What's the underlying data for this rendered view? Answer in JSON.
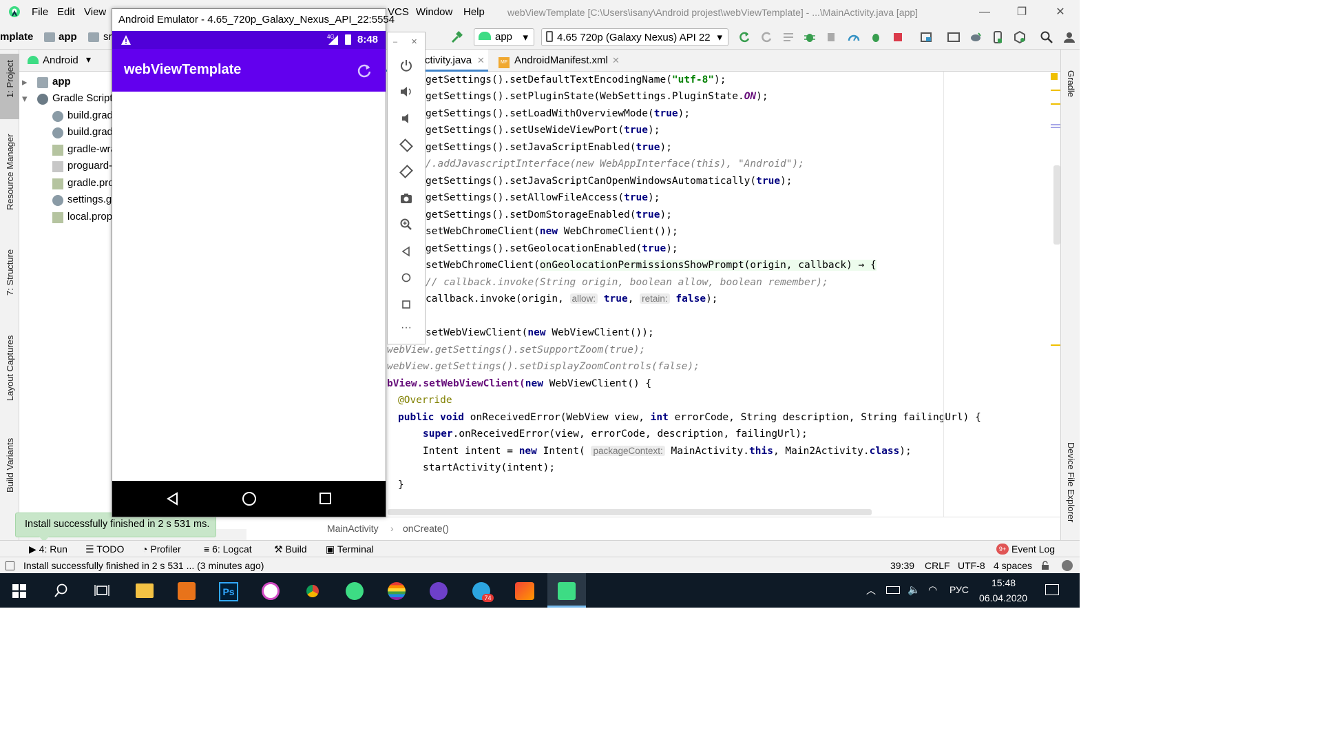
{
  "menu": {
    "items": [
      "File",
      "Edit",
      "View",
      "VCS",
      "Window",
      "Help"
    ],
    "window_title": "webViewTemplate [C:\\Users\\isany\\Android projest\\webViewTemplate] - ...\\MainActivity.java [app]"
  },
  "toolbar": {
    "crumb_project": "mplate",
    "crumb_app": "app",
    "crumb_src": "sr",
    "run_config": "app",
    "device": "4.65  720p (Galaxy Nexus) API 22"
  },
  "left_tabs": {
    "project": "1: Project",
    "resource_manager": "Resource Manager",
    "structure": "7: Structure",
    "layout_captures": "Layout Captures",
    "build_variants": "Build Variants"
  },
  "right_tabs": {
    "gradle": "Gradle",
    "device_explorer": "Device File Explorer"
  },
  "project_panel": {
    "view_mode": "Android",
    "items": [
      "app",
      "Gradle Scripts",
      "build.grad",
      "build.grad",
      "gradle-wra",
      "proguard-",
      "gradle.pro",
      "settings.g",
      "local.prop"
    ]
  },
  "editor_tabs": [
    "ctivity.java",
    "AndroidManifest.xml"
  ],
  "code": {
    "l1a": "getSettings().setDefaultTextEncodingName(",
    "l1s": "\"utf-8\"",
    "l1b": ");",
    "l2a": "getSettings().setPluginState(WebSettings.PluginState.",
    "l2f": "ON",
    "l2b": ");",
    "l3a": "getSettings().setLoadWithOverviewMode(",
    "l3k": "true",
    "l3b": ");",
    "l4a": "getSettings().setUseWideViewPort(",
    "l4k": "true",
    "l4b": ");",
    "l5a": "getSettings().setJavaScriptEnabled(",
    "l5k": "true",
    "l5b": ");",
    "l6": "/.addJavascriptInterface(new WebAppInterface(this), \"Android\");",
    "l7a": "getSettings().setJavaScriptCanOpenWindowsAutomatically(",
    "l7k": "true",
    "l7b": ");",
    "l8a": "getSettings().setAllowFileAccess(",
    "l8k": "true",
    "l8b": ");",
    "l9a": "getSettings().setDomStorageEnabled(",
    "l9k": "true",
    "l9b": ");",
    "l10a": "setWebChromeClient(",
    "l10k": "new",
    "l10b": " WebChromeClient());",
    "l11a": "getSettings().setGeolocationEnabled(",
    "l11k": "true",
    "l11b": ");",
    "l12a": "setWebChromeClient(",
    "l12h": "onGeolocationPermissionsShowPrompt(origin, callback) → {",
    "l13": "// callback.invoke(String origin, boolean allow, boolean remember);",
    "l14a": "callback.invoke(origin, ",
    "l14h1": "allow:",
    "l14k1": " true",
    "l14c": ", ",
    "l14h2": "retain:",
    "l14k2": " false",
    "l14b": ");",
    "l16a": "setWebViewClient(",
    "l16k": "new",
    "l16b": " WebViewClient());",
    "l17": "webView.getSettings().setSupportZoom(true);",
    "l18": "webView.getSettings().setDisplayZoomControls(false);",
    "l19a": "bView.setWebViewClient(",
    "l19k": "new",
    "l19b": " WebViewClient() {",
    "l20": "@Override",
    "l21k": "public void",
    "l21a": " onReceivedError(WebView view, ",
    "l21k2": "int",
    "l21b": " errorCode, String description, String failingUrl) {",
    "l22k": "super",
    "l22a": ".onReceivedError(view, errorCode, description, failingUrl);",
    "l23a": "Intent intent = ",
    "l23k": "new",
    "l23b": " Intent( ",
    "l23h": "packageContext:",
    "l23c": " MainActivity.",
    "l23k2": "this",
    "l23d": ", Main2Activity.",
    "l23k3": "class",
    "l23e": ");",
    "l24": "startActivity(intent);",
    "l25": "}"
  },
  "breadcrumb": {
    "cls": "MainActivity",
    "method": "onCreate()"
  },
  "tool_windows": {
    "run": "4: Run",
    "todo": "TODO",
    "profiler": "Profiler",
    "logcat": "6: Logcat",
    "build": "Build",
    "terminal": "Terminal",
    "event_log": "Event Log",
    "event_badge": "9+"
  },
  "status": {
    "message": "Install successfully finished in 2 s 531 ... (3 minutes ago)",
    "position": "39:39",
    "line_sep": "CRLF",
    "encoding": "UTF-8",
    "indent": "4 spaces"
  },
  "popup": {
    "message": "Install successfully finished in 2 s 531 ms."
  },
  "emulator": {
    "title": "Android Emulator - 4.65_720p_Galaxy_Nexus_API_22:5554",
    "time": "8:48",
    "network": "4G",
    "app_title": "webViewTemplate"
  },
  "taskbar": {
    "lang": "РУС",
    "time": "15:48",
    "date": "06.04.2020",
    "telegram_badge": "74"
  },
  "colors": {
    "app_bar": "#6200ee",
    "status_bar": "#5000d8"
  }
}
